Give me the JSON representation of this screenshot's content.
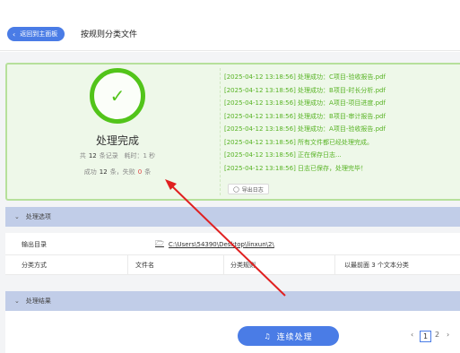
{
  "header": {
    "back_label": "返回到主面板",
    "page_title": "按规则分类文件"
  },
  "result": {
    "title": "处理完成",
    "total_prefix": "共",
    "total_count": "12",
    "total_suffix": "条记录",
    "time_prefix": "耗时：",
    "time_value": "1",
    "time_suffix": "秒",
    "success_prefix": "成功",
    "success_count": "12",
    "success_suffix": "条，失败",
    "fail_count": "0",
    "fail_suffix": "条",
    "export_label": "导出日志",
    "log": [
      "[2025-04-12 13:18:56] 处理成功：C项目-验收报告.pdf",
      "[2025-04-12 13:18:56] 处理成功：B项目-时长分析.pdf",
      "[2025-04-12 13:18:56] 处理成功：A项目-项目进度.pdf",
      "[2025-04-12 13:18:56] 处理成功：B项目-审计报告.pdf",
      "[2025-04-12 13:18:56] 处理成功：A项目-验收报告.pdf",
      "[2025-04-12 13:18:56] 所有文件都已经处理完成。",
      "[2025-04-12 13:18:56] 正在保存日志...",
      "[2025-04-12 13:18:56] 日志已保存，处理完毕！"
    ]
  },
  "options": {
    "section_label": "处理选项",
    "output_label": "输出目录",
    "output_path": "C:\\Users\\54390\\Desktop\\linxun\\2\\",
    "method_label": "分类方式",
    "method_value": "文件名",
    "rule_label": "分类规则",
    "rule_value": "以最前面 3 个文本分类"
  },
  "results_section": {
    "label": "处理结果"
  },
  "actions": {
    "run_label": "连续处理"
  },
  "pager": {
    "current": "1",
    "next": "2"
  },
  "colors": {
    "accent": "#4a7ce6",
    "success": "#52c41a",
    "fail": "#e03c3c",
    "annotation": "#e02020"
  }
}
